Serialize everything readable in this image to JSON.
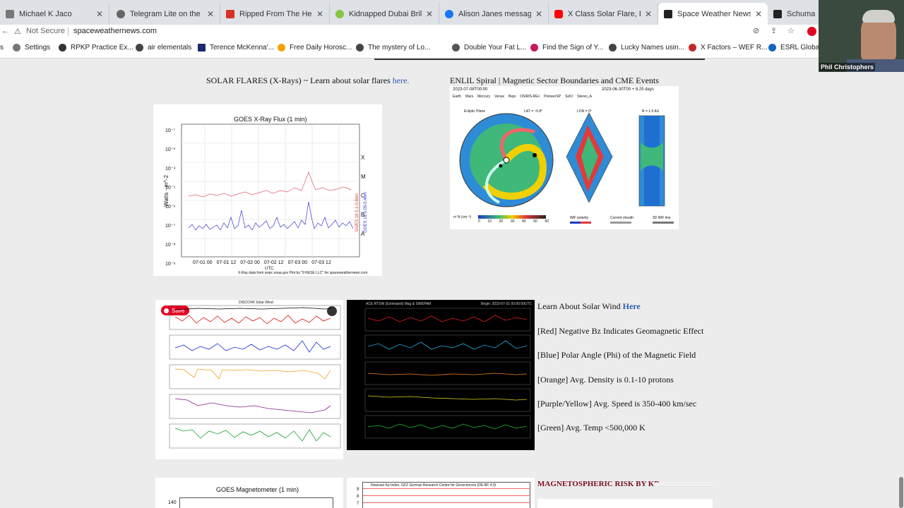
{
  "tabs": [
    {
      "title": "Michael K Jaco",
      "icon": "bird-icon",
      "color": "#555555",
      "active": false
    },
    {
      "title": "Telegram Lite on the Mac",
      "icon": "globe-icon",
      "color": "#555555",
      "active": false
    },
    {
      "title": "Ripped From The Headlin",
      "icon": "gmail-icon",
      "color": "#d93025",
      "active": false
    },
    {
      "title": "Kidnapped Dubai Brillianc",
      "icon": "rumble-icon",
      "color": "#85c742",
      "active": false
    },
    {
      "title": "Alison Janes messaged F",
      "icon": "facebook-icon",
      "color": "#1877f2",
      "active": false
    },
    {
      "title": "X Class Solar Flare, Brain",
      "icon": "youtube-icon",
      "color": "#ff0000",
      "active": false
    },
    {
      "title": "Space Weather News",
      "icon": "site-icon",
      "color": "#222222",
      "active": true
    },
    {
      "title": "Schumann",
      "icon": "site-icon",
      "color": "#222222",
      "active": false
    }
  ],
  "address": {
    "security": "Not Secure",
    "url": "spaceweathernews.com"
  },
  "bookmarks": [
    {
      "label": "Settings",
      "icon": "gear-icon",
      "color": "#666666"
    },
    {
      "label": "RPKP Practice Ex...",
      "icon": "rpkp-icon",
      "color": "#333333"
    },
    {
      "label": "air elementals",
      "icon": "globe-icon",
      "color": "#444444"
    },
    {
      "label": "Terence McKenna'...",
      "icon": "site-icon",
      "color": "#1b2a6b"
    },
    {
      "label": "Free Daily Horosc...",
      "icon": "sun-icon",
      "color": "#f4a300"
    },
    {
      "label": "The mystery of Lo...",
      "icon": "globe-icon",
      "color": "#444444"
    },
    {
      "label": "Double Your Fat L...",
      "icon": "feather-icon",
      "color": "#555555"
    },
    {
      "label": "Find the Sign of Y...",
      "icon": "c-icon",
      "color": "#c2185b"
    },
    {
      "label": "Lucky Names usin...",
      "icon": "globe-icon",
      "color": "#444444"
    },
    {
      "label": "X Factors – WEF R...",
      "icon": "x-icon",
      "color": "#c62828"
    },
    {
      "label": "ESRL Global",
      "icon": "noaa-icon",
      "color": "#1565c0"
    }
  ],
  "webcam": {
    "name": "Phil Christophers"
  },
  "content": {
    "solar_flares": {
      "text": "SOLAR FLARES (X-Rays) ~ Learn about solar flares ",
      "link": "here."
    },
    "enlil": {
      "text": "ENLIL Spiral | Magnetic Sector Boundaries and CME Events"
    },
    "goes_xray": {
      "title": "GOES X-Ray Flux (1 min)",
      "ylabel": "Watts · m^-2",
      "xlabel": "UTC",
      "yticks": [
        "10⁻⁷",
        "10⁻³",
        "10⁻⁴",
        "10⁻⁵",
        "10⁻⁶",
        "10⁻⁷",
        "10⁻⁸",
        "10⁻⁹"
      ],
      "xticks": [
        "07-01 00",
        "07-01 12",
        "07-02 00",
        "07-02 12",
        "07-03 00",
        "07-03 12"
      ],
      "classes": [
        "X",
        "M",
        "C",
        "B",
        "A"
      ],
      "legend_long": "GOES 16 0.1-0.8nm",
      "legend_short": "GOES 16 0.05-0.4nm",
      "credit": "X-Ray data from swpc.noaa.gov  Plot by \"9 RESE LLC\" for spaceweathernews.com"
    },
    "enlil_img": {
      "left_date": "2023-07-08T00:00",
      "right_date": "2023-06-30T00 + 8.25 days",
      "legend": [
        "Earth",
        "Mars",
        "Mercury",
        "Venus",
        "Bepi",
        "OSIRIS-REx",
        "PioneerSP",
        "SolO",
        "Stereo_A"
      ],
      "plane": "Ecliptic Plane",
      "lat": "LAT = ~0.8°",
      "lon": "LON = 0°",
      "r": "R = 1.0 AU",
      "colorbar_label": "n² N (cm⁻³)",
      "colorbar_ticks": [
        "0",
        "10",
        "20",
        "30",
        "40",
        "50",
        "60"
      ],
      "imf_polarity": "IMF polarity",
      "current_sheet": "Current sheath",
      "imf_line": "3D IMF line"
    },
    "discovr": {
      "title": "DISCOVR Solar Wind",
      "save": "Save"
    },
    "ace": {
      "title": "ACE RTSW (Estimated) Mag & SWEPAM",
      "begin": "Begin: 2023-07-01 00:00:00UTC"
    },
    "solar_wind": {
      "learn": "Learn About Solar Wind ",
      "link": "Here",
      "items": [
        "[Red] Negative Bz Indicates Geomagnetic Effect",
        "[Blue] Polar Angle (Phi) of the Magnetic Field",
        "[Orange] Avg. Density is 0.1-10 protons",
        "[Purple/Yellow] Avg. Speed is 350-400 km/sec",
        "[Green] Avg. Temp <500,000 K"
      ]
    },
    "goes_mag": {
      "title": "GOES Magnetometer (1 min)",
      "ytick": "140"
    },
    "kp": {
      "title": "Nowcast Kp Index, GFZ German Research Centre for Geosciences (DE-BF 4.0)",
      "yticks": [
        "9",
        "8",
        "7"
      ]
    },
    "magneto": {
      "title": "MAGNETOSPHERIC RISK BY KP"
    }
  }
}
